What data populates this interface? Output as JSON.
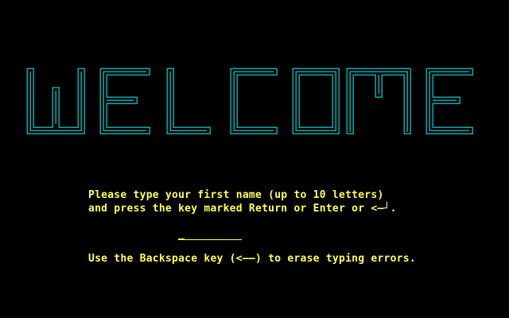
{
  "banner": {
    "title": "WELCOME",
    "color": "#00aaaa"
  },
  "instructions": {
    "color": "#ffff55",
    "line1": "Please type your first name (up to 10 letters)",
    "line2": "and press the key marked Return or Enter or <—┘.",
    "line3": "Use the Backspace key (<——) to erase typing errors."
  },
  "name_input": {
    "value": "",
    "max_length": 10
  }
}
